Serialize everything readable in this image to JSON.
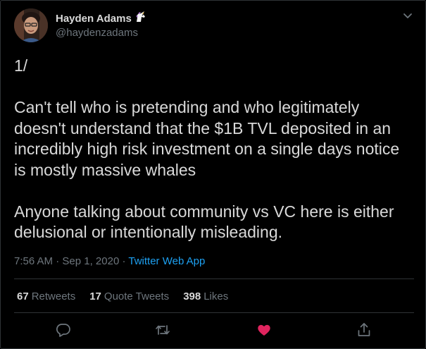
{
  "author": {
    "display_name": "Hayden Adams",
    "handle": "@haydenzadams",
    "badge_icon": "unicorn-icon"
  },
  "tweet": {
    "text": "1/\n\nCan't tell who is pretending and who legitimately doesn't understand that the $1B TVL deposited in an incredibly high risk investment on a single days notice is mostly massive whales\n\nAnyone talking about community vs VC here is either delusional or intentionally misleading.",
    "time": "7:56 AM",
    "separator": "·",
    "date": "Sep 1, 2020",
    "source": "Twitter Web App"
  },
  "stats": {
    "retweets_count": "67",
    "retweets_label": "Retweets",
    "quotes_count": "17",
    "quotes_label": "Quote Tweets",
    "likes_count": "398",
    "likes_label": "Likes"
  },
  "colors": {
    "background": "#000000",
    "text": "#d9d9d9",
    "muted": "#6e767d",
    "link": "#1da1f2",
    "like": "#e0245e",
    "border": "#2f3336"
  },
  "actions": [
    "reply-icon",
    "retweet-icon",
    "like-icon",
    "share-icon"
  ]
}
